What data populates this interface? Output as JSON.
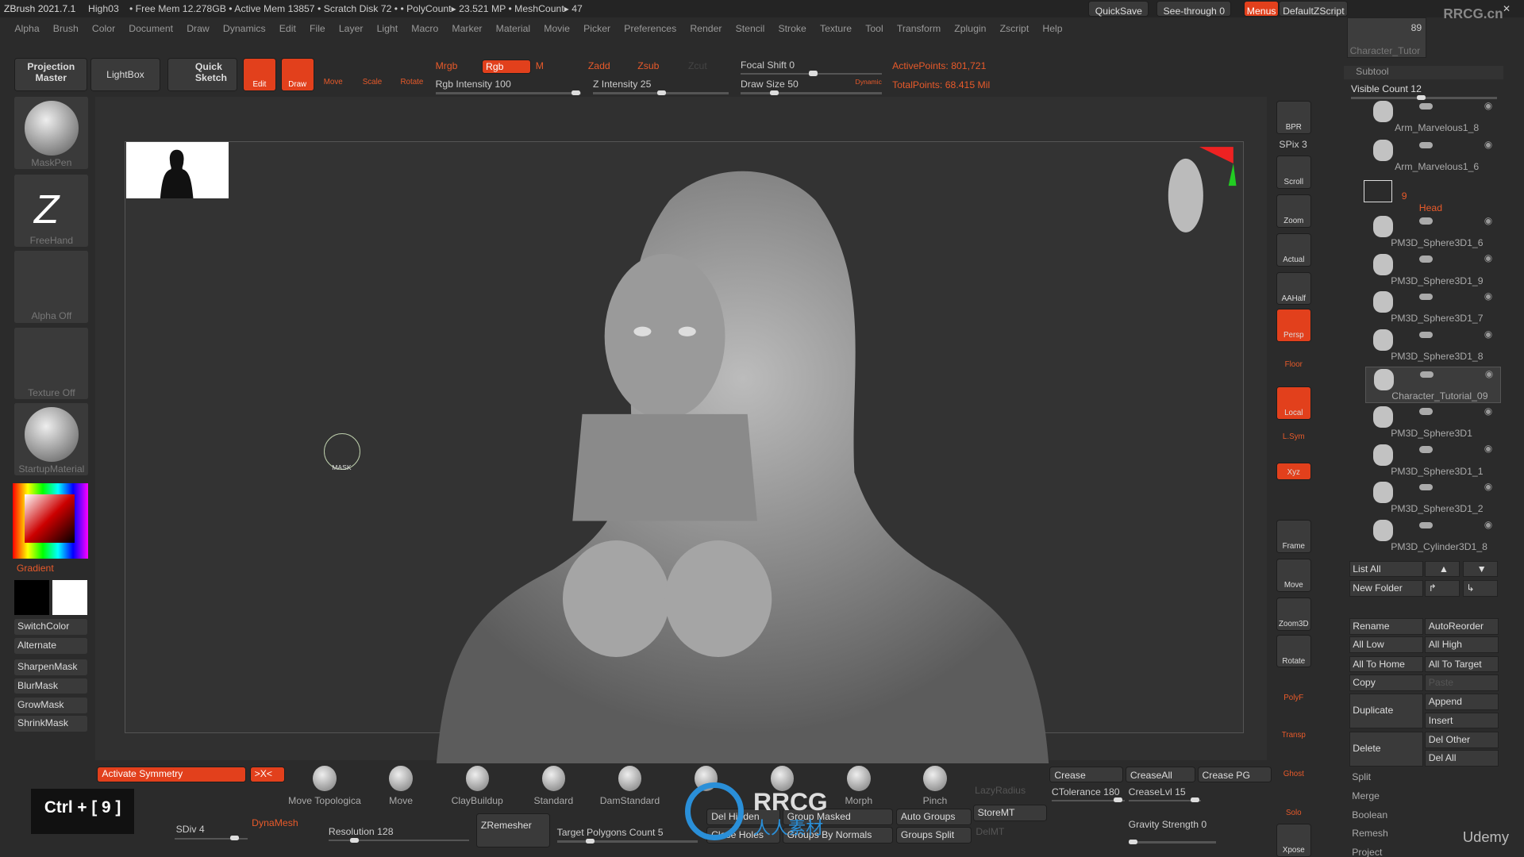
{
  "title_bar": {
    "app": "ZBrush 2021.7.1",
    "file": "High03",
    "stats": "• Free Mem 12.278GB • Active Mem 13857 • Scratch Disk 72 • • PolyCount▸ 23.521 MP • MeshCount▸ 47",
    "quicksave": "QuickSave",
    "seethrough": "See-through 0",
    "menus": "Menus",
    "script": "DefaultZScript"
  },
  "menu": [
    "Alpha",
    "Brush",
    "Color",
    "Document",
    "Draw",
    "Dynamics",
    "Edit",
    "File",
    "Layer",
    "Light",
    "Macro",
    "Marker",
    "Material",
    "Movie",
    "Picker",
    "Preferences",
    "Render",
    "Stencil",
    "Stroke",
    "Texture",
    "Tool",
    "Transform",
    "Zplugin",
    "Zscript",
    "Help"
  ],
  "toolbar": {
    "projection": "Projection Master",
    "lightbox": "LightBox",
    "quicksketch": "Quick Sketch",
    "edit": "Edit",
    "draw": "Draw",
    "move": "Move",
    "scale": "Scale",
    "rotate": "Rotate",
    "mrgb": "Mrgb",
    "rgb": "Rgb",
    "m": "M",
    "zadd": "Zadd",
    "zsub": "Zsub",
    "zcut": "Zcut",
    "rgb_intensity": "Rgb Intensity 100",
    "z_intensity": "Z Intensity 25",
    "focal_shift": "Focal Shift 0",
    "draw_size": "Draw Size 50",
    "dynamic": "Dynamic",
    "active_points": "ActivePoints: 801,721",
    "total_points": "TotalPoints: 68.415 Mil"
  },
  "left": {
    "tiles": [
      "MaskPen",
      "FreeHand",
      "Alpha Off",
      "Texture Off",
      "StartupMaterial"
    ],
    "gradient": "Gradient",
    "buttons": [
      "SwitchColor",
      "Alternate",
      "SharpenMask",
      "BlurMask",
      "GrowMask",
      "ShrinkMask"
    ],
    "shortcut": "Ctrl + [ 9 ]"
  },
  "canvas": {
    "cursor_label": "MASK"
  },
  "right_shelf": [
    "BPR",
    "SPix 3",
    "Scroll",
    "Zoom",
    "Actual",
    "AAHalf",
    "Persp",
    "Floor",
    "Local",
    "L.Sym",
    "Xyz",
    "Frame",
    "Move",
    "Zoom3D",
    "Rotate",
    "PolyF",
    "Transp",
    "Ghost",
    "Solo",
    "Xpose"
  ],
  "tool": {
    "count": "89",
    "name": "Character_Tutor"
  },
  "subtool": {
    "header": "Subtool",
    "visible_count": "Visible Count 12",
    "folder_count": "9",
    "folder_name": "Head",
    "items": [
      "Arm_Marvelous1_8",
      "Arm_Marvelous1_6",
      "PM3D_Sphere3D1_6",
      "PM3D_Sphere3D1_9",
      "PM3D_Sphere3D1_7",
      "PM3D_Sphere3D1_8",
      "Character_Tutorial_09",
      "PM3D_Sphere3D1",
      "PM3D_Sphere3D1_1",
      "PM3D_Sphere3D1_2",
      "PM3D_Cylinder3D1_8"
    ],
    "list_all": "List All",
    "new_folder": "New Folder",
    "rename": "Rename",
    "autoreorder": "AutoReorder",
    "all_low": "All Low",
    "all_high": "All High",
    "all_to_home": "All To Home",
    "all_to_target": "All To Target",
    "copy": "Copy",
    "paste": "Paste",
    "duplicate": "Duplicate",
    "append": "Append",
    "insert": "Insert",
    "delete": "Delete",
    "del_other": "Del Other",
    "del_all": "Del All",
    "split": "Split",
    "merge": "Merge",
    "boolean": "Boolean",
    "remesh": "Remesh",
    "project": "Project"
  },
  "bottom": {
    "activate_symmetry": "Activate Symmetry",
    "x": ">X<",
    "brushes": [
      "Move Topologica",
      "Move",
      "ClayBuildup",
      "Standard",
      "DamStandard",
      "",
      "",
      "Morph",
      "Pinch"
    ],
    "lazy": "LazyRadius",
    "sdiv": "SDiv 4",
    "dynamesh": "DynaMesh",
    "resolution": "Resolution 128",
    "zremesher": "ZRemesher",
    "target": "Target Polygons Count 5",
    "del_hidden": "Del Hidden",
    "close_holes": "Close Holes",
    "group_masked": "Group Masked",
    "groups_by_normals": "Groups By Normals",
    "auto_groups": "Auto Groups",
    "groups_split": "Groups Split",
    "storemt": "StoreMT",
    "delmt": "DelMT",
    "crease": "Crease",
    "creaseall": "CreaseAll",
    "crease_pg": "Crease PG",
    "ctolerance": "CTolerance 180",
    "creaselvl": "CreaseLvl 15",
    "gravity": "Gravity Strength 0"
  },
  "watermarks": {
    "rrcg": "RRCG",
    "cn": "人人素材",
    "site": "RRCG.cn",
    "udemy": "Udemy"
  },
  "colors": {
    "accent": "#e2401c",
    "bg": "#2b2b2b",
    "viewport": "#333333"
  }
}
